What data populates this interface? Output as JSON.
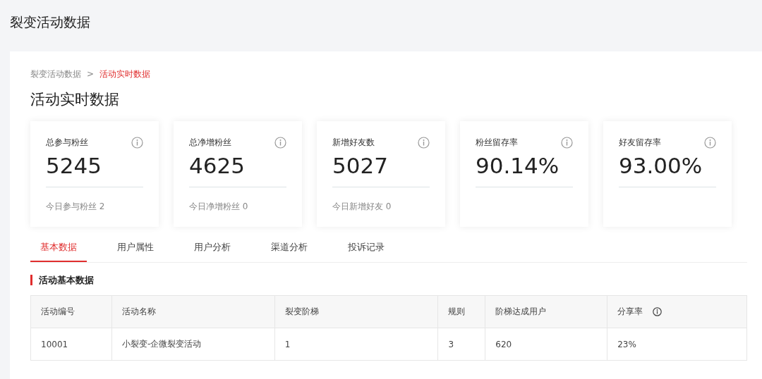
{
  "page_title": "裂变活动数据",
  "breadcrumb": [
    {
      "label": "裂变活动数据",
      "selected": false
    },
    {
      "label": "活动实时数据",
      "selected": true
    }
  ],
  "breadcrumb_separator": ">",
  "section_title": "活动实时数据",
  "stats": [
    {
      "label": "总参与粉丝",
      "value": "5245",
      "footer": "今日参与粉丝 2"
    },
    {
      "label": "总净增粉丝",
      "value": "4625",
      "footer": "今日净增粉丝 0"
    },
    {
      "label": "新增好友数",
      "value": "5027",
      "footer": "今日新增好友 0"
    },
    {
      "label": "粉丝留存率",
      "value": "90.14%"
    },
    {
      "label": "好友留存率",
      "value": "93.00%"
    }
  ],
  "tabs": [
    {
      "label": "基本数据",
      "selected": true
    },
    {
      "label": "用户属性",
      "selected": false
    },
    {
      "label": "用户分析",
      "selected": false
    },
    {
      "label": "渠道分析",
      "selected": false
    },
    {
      "label": "投诉记录",
      "selected": false
    }
  ],
  "table_title": "活动基本数据",
  "table": {
    "columns": [
      {
        "label": "活动编号",
        "info": false
      },
      {
        "label": "活动名称",
        "info": false
      },
      {
        "label": "裂变阶梯",
        "info": false
      },
      {
        "label": "规则",
        "info": false
      },
      {
        "label": "阶梯达成用户",
        "info": false
      },
      {
        "label": "分享率",
        "info": true
      }
    ],
    "rows": [
      [
        "10001",
        "小裂变-企微裂变活动",
        "1",
        "3",
        "620",
        "23%"
      ]
    ]
  }
}
